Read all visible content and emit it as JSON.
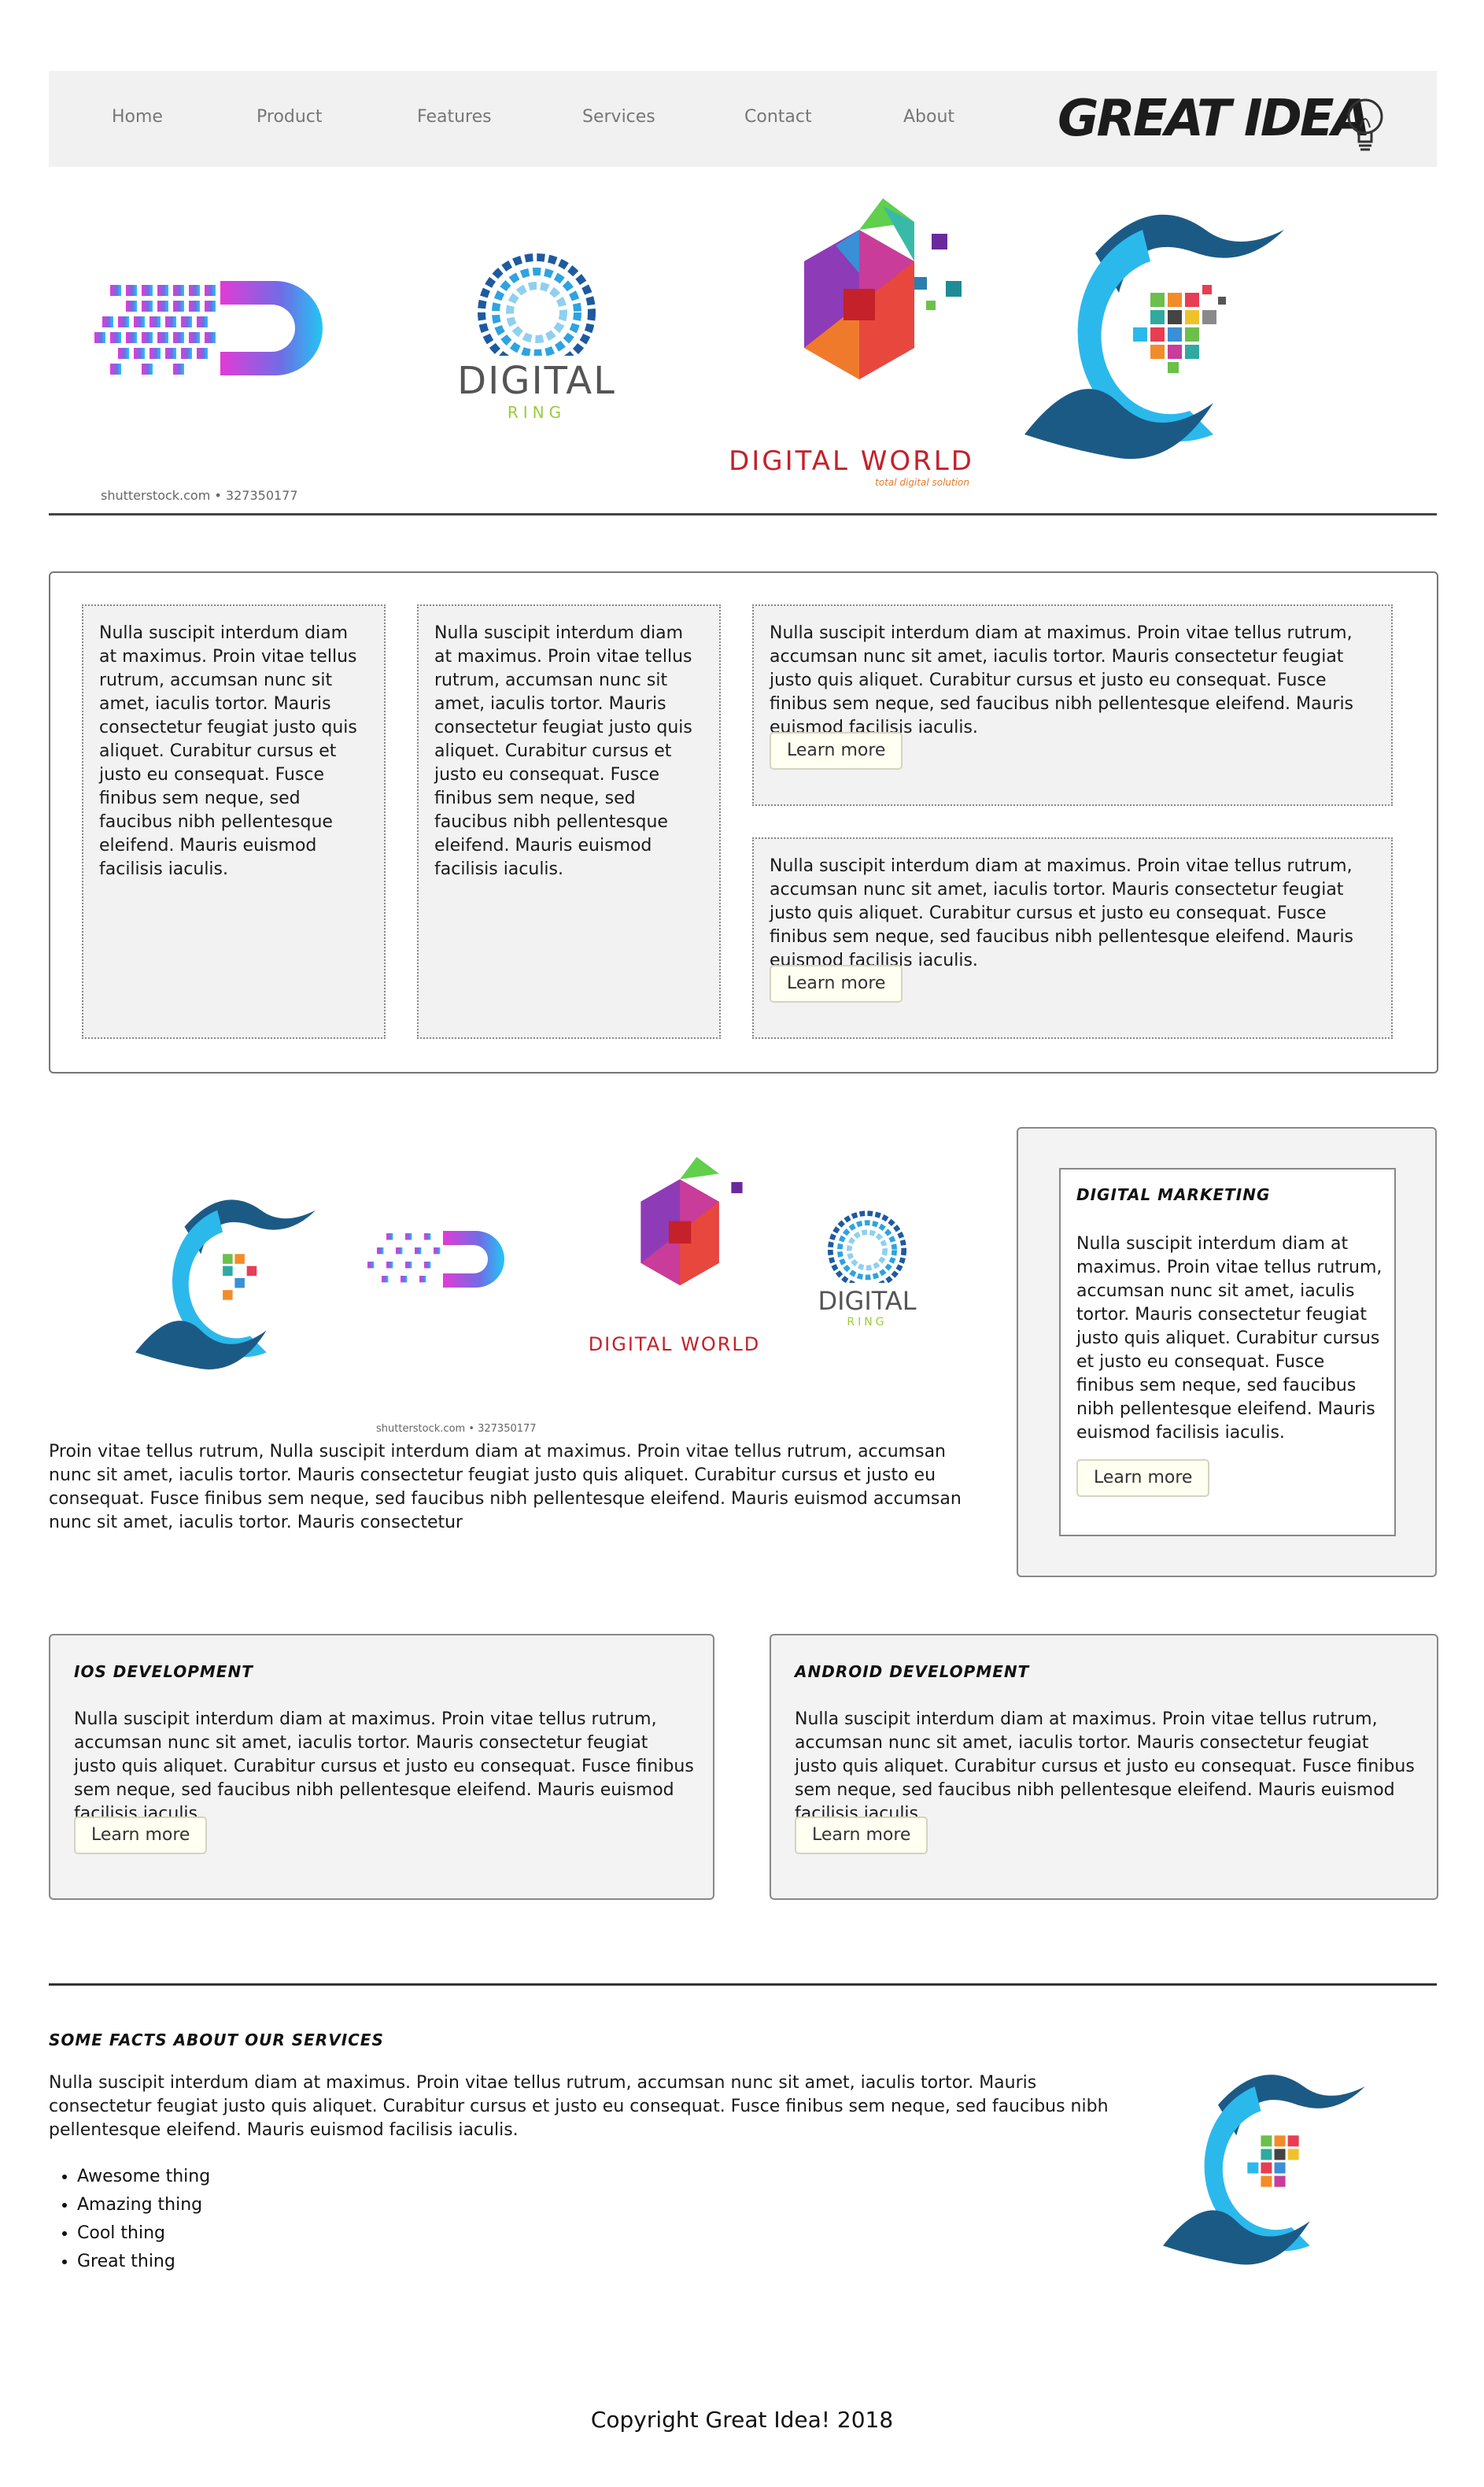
{
  "nav": {
    "items": [
      {
        "label": "Home"
      },
      {
        "label": "Product"
      },
      {
        "label": "Features"
      },
      {
        "label": "Services"
      },
      {
        "label": "Contact"
      },
      {
        "label": "About"
      }
    ],
    "brand": "GREAT IDEA"
  },
  "hero": {
    "logos": [
      "D",
      "DIGITAL",
      "RING",
      "DIGITAL WORLD",
      "total digital solution"
    ],
    "credit": "shutterstock.com • 327350177"
  },
  "features": {
    "col1_text": "Nulla suscipit interdum diam at maximus. Proin vitae tellus rutrum, accumsan nunc sit amet, iaculis tortor. Mauris consectetur feugiat justo quis aliquet. Curabitur cursus et justo eu consequat. Fusce finibus sem neque, sed faucibus nibh pellentesque eleifend. Mauris euismod facilisis iaculis.",
    "col2_text": "Nulla suscipit interdum diam at maximus. Proin vitae tellus rutrum, accumsan nunc sit amet, iaculis tortor. Mauris consectetur feugiat justo quis aliquet. Curabitur cursus et justo eu consequat. Fusce finibus sem neque, sed faucibus nibh pellentesque eleifend. Mauris euismod facilisis iaculis.",
    "box1_text": "Nulla suscipit interdum diam at maximus. Proin vitae tellus rutrum, accumsan nunc sit amet, iaculis tortor. Mauris consectetur feugiat justo quis aliquet. Curabitur cursus et justo eu consequat. Fusce finibus sem neque, sed faucibus nibh pellentesque eleifend. Mauris euismod facilisis iaculis.",
    "box1_button": "Learn more",
    "box2_text": "Nulla suscipit interdum diam at maximus. Proin vitae tellus rutrum, accumsan nunc sit amet, iaculis tortor. Mauris consectetur feugiat justo quis aliquet. Curabitur cursus et justo eu consequat. Fusce finibus sem neque, sed faucibus nibh pellentesque eleifend. Mauris euismod facilisis iaculis.",
    "box2_button": "Learn more"
  },
  "showcase": {
    "credit": "shutterstock.com • 327350177",
    "caption": "Proin vitae tellus rutrum, Nulla suscipit interdum diam at maximus. Proin vitae tellus rutrum, accumsan nunc sit amet, iaculis tortor. Mauris consectetur feugiat justo quis aliquet. Curabitur cursus et justo eu consequat. Fusce finibus sem neque, sed faucibus nibh pellentesque eleifend. Mauris euismod accumsan nunc sit amet, iaculis tortor. Mauris consectetur"
  },
  "marketing": {
    "title": "DIGITAL MARKETING",
    "text": "Nulla suscipit interdum diam at maximus. Proin vitae tellus rutrum, accumsan nunc sit amet, iaculis tortor. Mauris consectetur feugiat justo quis aliquet. Curabitur cursus et justo eu consequat. Fusce finibus sem neque, sed faucibus nibh pellentesque eleifend. Mauris euismod facilisis iaculis.",
    "button": "Learn more"
  },
  "ios": {
    "title": "IOS DEVELOPMENT",
    "text": "Nulla suscipit interdum diam at maximus. Proin vitae tellus rutrum, accumsan nunc sit amet, iaculis tortor. Mauris consectetur feugiat justo quis aliquet. Curabitur cursus et justo eu consequat. Fusce finibus sem neque, sed faucibus nibh pellentesque eleifend. Mauris euismod facilisis iaculis.",
    "button": "Learn more"
  },
  "android": {
    "title": "ANDROID DEVELOPMENT",
    "text": "Nulla suscipit interdum diam at maximus. Proin vitae tellus rutrum, accumsan nunc sit amet, iaculis tortor. Mauris consectetur feugiat justo quis aliquet. Curabitur cursus et justo eu consequat. Fusce finibus sem neque, sed faucibus nibh pellentesque eleifend. Mauris euismod facilisis iaculis.",
    "button": "Learn more"
  },
  "facts": {
    "title": "SOME FACTS ABOUT OUR SERVICES",
    "text": "Nulla suscipit interdum diam at maximus. Proin vitae tellus rutrum, accumsan nunc sit amet, iaculis tortor. Mauris consectetur feugiat justo quis aliquet. Curabitur cursus et justo eu consequat. Fusce finibus sem neque, sed faucibus nibh pellentesque eleifend. Mauris euismod facilisis iaculis.",
    "items": [
      "Awesome thing",
      "Amazing thing",
      "Cool thing",
      "Great thing"
    ]
  },
  "footer": {
    "copyright": "Copyright Great Idea! 2018"
  }
}
